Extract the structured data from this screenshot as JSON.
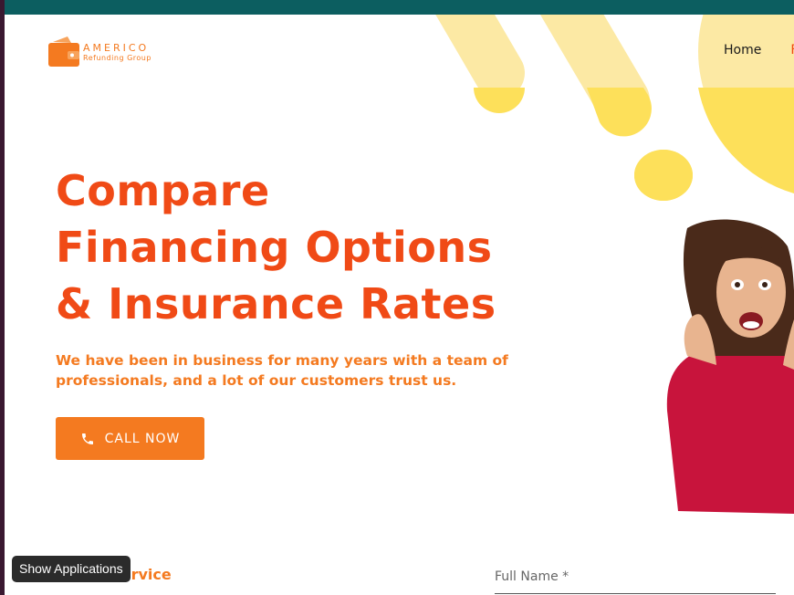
{
  "brand": {
    "name": "AMERICO",
    "subtitle": "Refunding Group",
    "logo_icon": "wallet-icon",
    "accent": "#f47a20",
    "headline_color": "#f04a16",
    "topbar_color": "#0c5e60"
  },
  "nav": {
    "items": [
      {
        "label": "Home"
      },
      {
        "label": "F"
      }
    ]
  },
  "hero": {
    "title_lines": [
      "Compare",
      "Financing Options",
      "& Insurance Rates"
    ],
    "subtitle": "We have been in business for many years with a team of professionals, and a lot of our customers trust us.",
    "cta": {
      "label": "CALL NOW",
      "icon": "phone-icon"
    }
  },
  "section": {
    "heading_visible": "k Service"
  },
  "form": {
    "fullname_placeholder": "Full Name *"
  },
  "system": {
    "tooltip": "Show Applications"
  }
}
